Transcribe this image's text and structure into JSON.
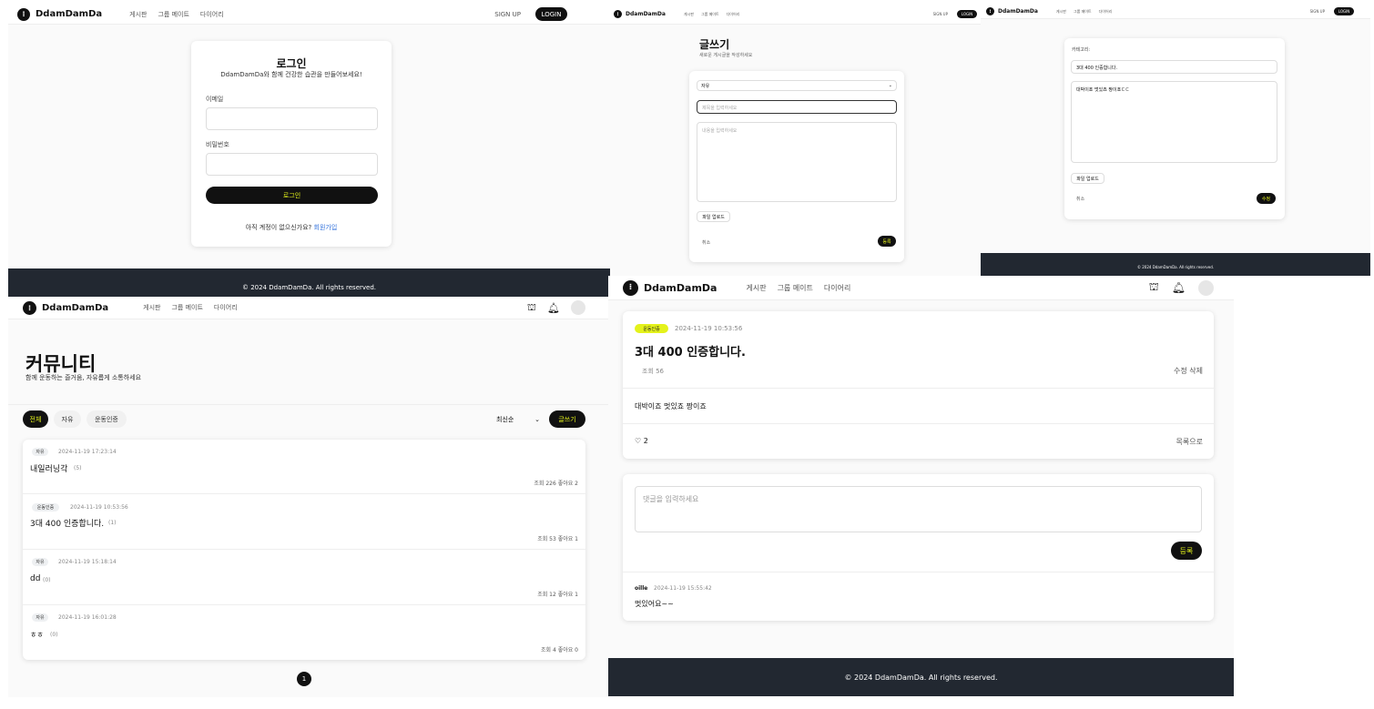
{
  "brand": {
    "name": "DdamDamDa",
    "logo_icon": "sprout-logo-icon"
  },
  "nav": {
    "board": "게시판",
    "group": "그룹 메이트",
    "diary": "다이어리"
  },
  "auth": {
    "signup": "SIGN UP",
    "login": "LOGIN"
  },
  "footer_text": "© 2024 DdamDamDa. All rights reserved.",
  "colors": {
    "accent": "#e4f21b",
    "dark": "#111111",
    "footer": "#222831",
    "link": "#2f6fdb"
  },
  "login_page": {
    "title": "로그인",
    "subtitle": "DdamDamDa와 함께 건강한 습관을 만들어보세요!",
    "email_label": "이메일",
    "password_label": "비밀번호",
    "submit": "로그인",
    "no_account": "아직 계정이 없으신가요?",
    "signup_link": "회원가입"
  },
  "write_page": {
    "title": "글쓰기",
    "subtitle": "새로운 게시글을 작성하세요",
    "category_value": "자유",
    "title_placeholder": "제목을 입력하세요",
    "content_placeholder": "내용을 입력하세요",
    "upload": "파일 업로드",
    "cancel": "취소",
    "submit": "등록"
  },
  "edit_page": {
    "category_label": "카테고리:",
    "title_value": "3대 400 인증합니다.",
    "content_value": "대박이죠 멋있죠 짱이죠ㄷㄷ",
    "upload": "파일 업로드",
    "cancel": "취소",
    "submit": "수정"
  },
  "community": {
    "title": "커뮤니티",
    "subtitle": "함께 운동하는 즐거움, 자유롭게 소통하세요",
    "tabs": [
      "전체",
      "자유",
      "운동인증"
    ],
    "sort_value": "최신순",
    "write_button": "글쓰기",
    "posts": [
      {
        "category": "자유",
        "date": "2024-11-19 17:23:14",
        "title": "내일러닝각",
        "comments": "(5)",
        "views": "조회 226",
        "likes": "좋아요 2"
      },
      {
        "category": "운동인증",
        "date": "2024-11-19 10:53:56",
        "title": "3대 400 인증합니다.",
        "comments": "(1)",
        "views": "조회 53",
        "likes": "좋아요 1"
      },
      {
        "category": "자유",
        "date": "2024-11-19 15:18:14",
        "title": "dd",
        "comments": "(0)",
        "views": "조회 12",
        "likes": "좋아요 1"
      },
      {
        "category": "자유",
        "date": "2024-11-19 16:01:28",
        "title": "ㅎㅎ",
        "comments": "(0)",
        "views": "조회 4",
        "likes": "좋아요 0"
      }
    ],
    "page": "1"
  },
  "detail": {
    "category": "운동인증",
    "date": "2024-11-19 10:53:56",
    "title": "3대 400 인증합니다.",
    "views": "조회 56",
    "edit": "수정",
    "delete": "삭제",
    "content": "대박이죠 멋있죠 짱이죠",
    "likes": "2",
    "back": "목록으로",
    "comment_placeholder": "댓글을 입력하세요",
    "comment_submit": "등록",
    "comments": [
      {
        "author": "oille",
        "date": "2024-11-19 15:55:42",
        "text": "멋있어요~~"
      }
    ]
  }
}
